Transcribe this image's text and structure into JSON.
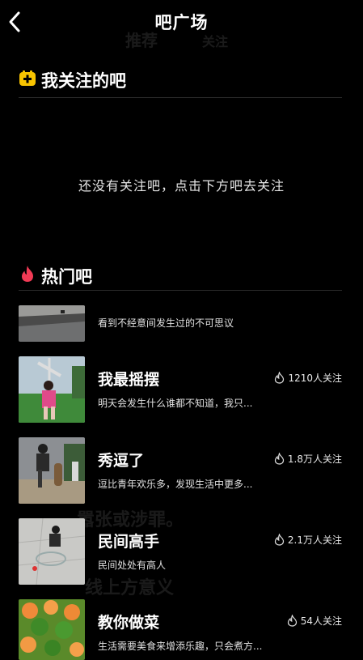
{
  "header": {
    "title": "吧广场"
  },
  "background": {
    "tab_1": "推荐",
    "tab_2": "关注",
    "line_1": "嚣张或涉罪。",
    "line_2": "线上方意义"
  },
  "following_section": {
    "title": "我关注的吧",
    "empty_message": "还没有关注吧，点击下方吧去关注"
  },
  "hot_section": {
    "title": "热门吧",
    "items": [
      {
        "name": "",
        "desc": "看到不经意间发生过的不可思议",
        "followers": ""
      },
      {
        "name": "我最摇摆",
        "desc": "明天会发生什么谁都不知道，我只...",
        "followers": "1210人关注"
      },
      {
        "name": "秀逗了",
        "desc": "逗比青年欢乐多，发现生活中更多...",
        "followers": "1.8万人关注"
      },
      {
        "name": "民间高手",
        "desc": "民间处处有高人",
        "followers": "2.1万人关注"
      },
      {
        "name": "教你做菜",
        "desc": "生活需要美食来增添乐趣，只会煮方...",
        "followers": "54人关注"
      }
    ]
  },
  "colors": {
    "accent_yellow": "#f8c400",
    "hot_red": "#f23a55",
    "background": "#000000"
  },
  "icons": {
    "back": "chevron-left-icon",
    "follow_section": "plus-square-icon",
    "hot_section": "flame-icon",
    "followers": "flame-outline-icon"
  }
}
